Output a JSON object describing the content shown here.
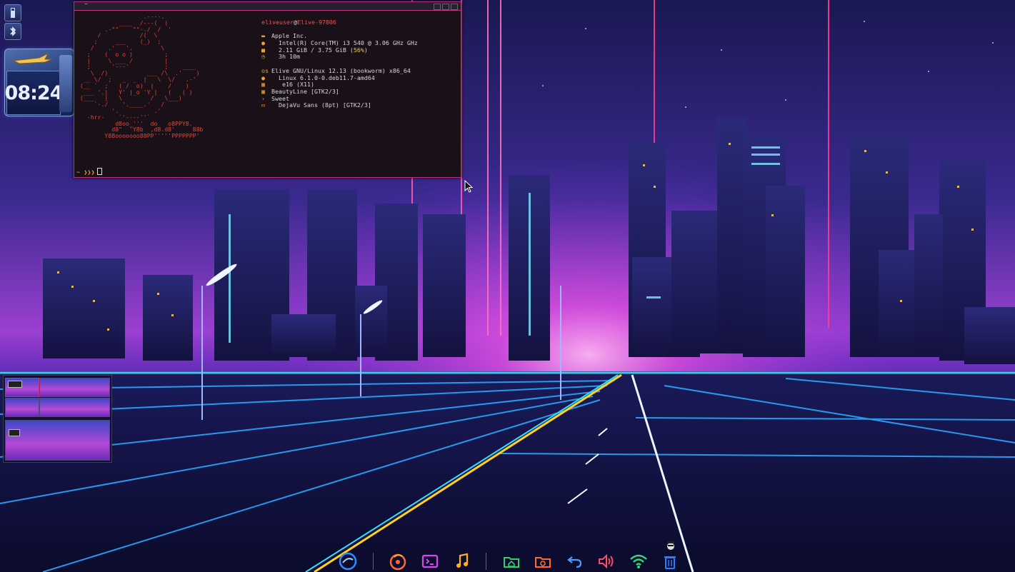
{
  "terminal": {
    "title": "~",
    "ascii_art": "                   .----.\n            ____  /---(  (\n        .-\"\"    \"\"-./  /  '\n      /           /(  \\\n     ;     ___    (_)  ;\n    /    .'   '.        \\\n   ;    (  o o )         ;\n   |     \\ ___ /         |\n   ;      '---'          ;    ____\n    \\  /)           ___ /\\  .'    )\n  __ \\/  ;   _  _  |   \\  \\/   .-'\n (__ `  ;   ( /  o)  |    /    )\n  ___ '.|   Y' |_o 'Y |   (   ( )\n (___   |   \\        /   \\___)\n     `-./    '.____.'   /\n          '.          .'\n   -hrr-    `'----''`\n           d8oo_'''  do   o8PPY8.\n          d8\"  'Y8b  ,d8.d8'     88b\n        Y88ooooooo88PP'''''PPPPPPP'",
    "user": "eliveuser",
    "at": "@",
    "host": "Elive-97806",
    "hw_vendor": "Apple Inc.",
    "cpu": "Intel(R) Core(TM) i3 540 @ 3.06 GHz GHz",
    "mem_prefix": "2.11 GiB / 3.75 GiB (",
    "mem_pct": "56%",
    "mem_suffix": ")",
    "uptime": "3h 10m",
    "os_label": "os",
    "os": "Elive GNU/Linux 12.13 (bookworm) x86_64",
    "kernel": "Linux 6.1.0-0.deb11.7-amd64",
    "wm": "e16 (X11)",
    "icons_theme": "BeautyLine [GTK2/3]",
    "gtk_theme": "Sweet",
    "font": "DejaVu Sans (8pt) [GTK2/3]",
    "prompt": "~ ❯❯❯"
  },
  "clock": {
    "time": "08:24"
  },
  "icons": {
    "tray_top": "usb-drive-icon",
    "tray_bottom": "bluetooth-icon"
  },
  "dock": {
    "items": [
      {
        "name": "elive-menu-icon",
        "color": "#2f8cff"
      },
      {
        "name": "firefox-icon",
        "color": "#ff6b2a"
      },
      {
        "name": "terminal-icon",
        "color": "#d946ef"
      },
      {
        "name": "music-player-icon",
        "color": "#ffb020"
      },
      {
        "name": "home-folder-icon",
        "color": "#2fd06a"
      },
      {
        "name": "screenshot-icon",
        "color": "#ff6a2a"
      },
      {
        "name": "undo-icon",
        "color": "#4a9bff"
      },
      {
        "name": "volume-icon",
        "color": "#ff4a6a"
      },
      {
        "name": "wifi-icon",
        "color": "#34d67a"
      },
      {
        "name": "trash-icon",
        "color": "#2f7bff"
      }
    ]
  }
}
